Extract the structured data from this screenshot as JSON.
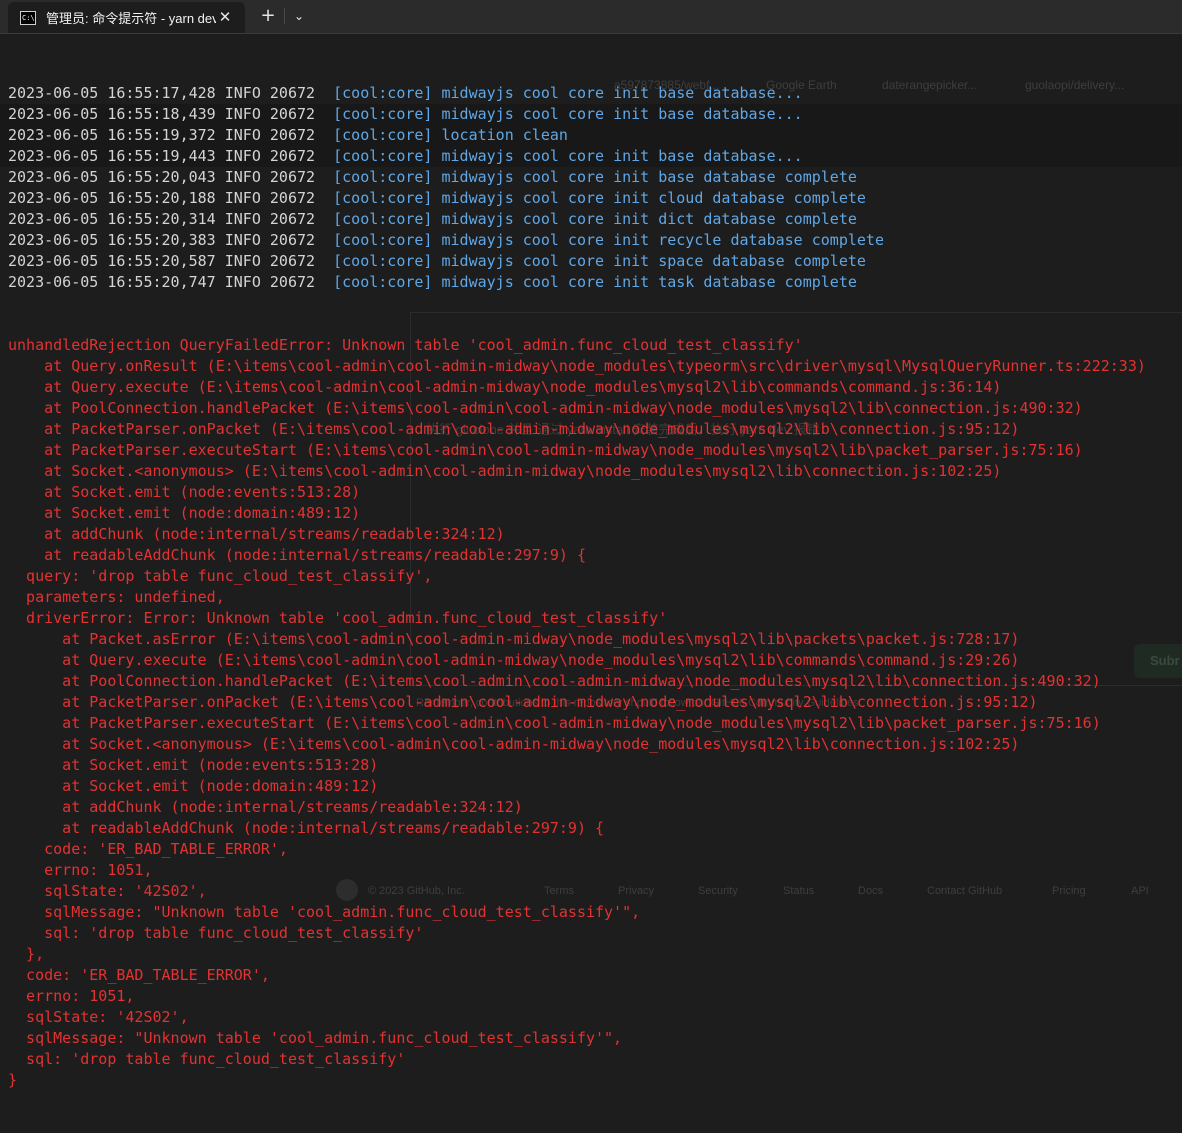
{
  "window": {
    "tab_title": "管理员: 命令提示符 - yarn  dev",
    "tab_icon_text": "C:\\",
    "close_glyph": "✕",
    "new_tab_glyph": "+",
    "dropdown_glyph": "⌄"
  },
  "background_ghost": {
    "bookmarks": [
      "a597873885/webf...",
      "Google Earth",
      "daterangepicker...",
      "guolaopi/delivery..."
    ],
    "comment_text": "执行 git clone 并且 通过 yarn install 安装完成后，执行 yarn dev 报错",
    "guidelines_text": "Remember, contributions to this repository should follow our GitHub Community Guidelines.",
    "submit_label": "Subr",
    "footer_copyright": "© 2023 GitHub, Inc.",
    "footer_links": [
      "Terms",
      "Privacy",
      "Security",
      "Status",
      "Docs",
      "Contact GitHub",
      "Pricing",
      "API"
    ]
  },
  "terminal": {
    "info_lines": [
      {
        "prefix": "2023-06-05 16:55:17,428 INFO 20672  ",
        "message": "[cool:core] midwayjs cool core init base database..."
      },
      {
        "prefix": "2023-06-05 16:55:18,439 INFO 20672  ",
        "message": "[cool:core] midwayjs cool core init base database..."
      },
      {
        "prefix": "2023-06-05 16:55:19,372 INFO 20672  ",
        "message": "[cool:core] location clean"
      },
      {
        "prefix": "2023-06-05 16:55:19,443 INFO 20672  ",
        "message": "[cool:core] midwayjs cool core init base database..."
      },
      {
        "prefix": "2023-06-05 16:55:20,043 INFO 20672  ",
        "message": "[cool:core] midwayjs cool core init base database complete"
      },
      {
        "prefix": "2023-06-05 16:55:20,188 INFO 20672  ",
        "message": "[cool:core] midwayjs cool core init cloud database complete"
      },
      {
        "prefix": "2023-06-05 16:55:20,314 INFO 20672  ",
        "message": "[cool:core] midwayjs cool core init dict database complete"
      },
      {
        "prefix": "2023-06-05 16:55:20,383 INFO 20672  ",
        "message": "[cool:core] midwayjs cool core init recycle database complete"
      },
      {
        "prefix": "2023-06-05 16:55:20,587 INFO 20672  ",
        "message": "[cool:core] midwayjs cool core init space database complete"
      },
      {
        "prefix": "2023-06-05 16:55:20,747 INFO 20672  ",
        "message": "[cool:core] midwayjs cool core init task database complete"
      }
    ],
    "error_lines": [
      "unhandledRejection QueryFailedError: Unknown table 'cool_admin.func_cloud_test_classify'",
      "    at Query.onResult (E:\\items\\cool-admin\\cool-admin-midway\\node_modules\\typeorm\\src\\driver\\mysql\\MysqlQueryRunner.ts:222:33)",
      "    at Query.execute (E:\\items\\cool-admin\\cool-admin-midway\\node_modules\\mysql2\\lib\\commands\\command.js:36:14)",
      "    at PoolConnection.handlePacket (E:\\items\\cool-admin\\cool-admin-midway\\node_modules\\mysql2\\lib\\connection.js:490:32)",
      "    at PacketParser.onPacket (E:\\items\\cool-admin\\cool-admin-midway\\node_modules\\mysql2\\lib\\connection.js:95:12)",
      "    at PacketParser.executeStart (E:\\items\\cool-admin\\cool-admin-midway\\node_modules\\mysql2\\lib\\packet_parser.js:75:16)",
      "    at Socket.<anonymous> (E:\\items\\cool-admin\\cool-admin-midway\\node_modules\\mysql2\\lib\\connection.js:102:25)",
      "    at Socket.emit (node:events:513:28)",
      "    at Socket.emit (node:domain:489:12)",
      "    at addChunk (node:internal/streams/readable:324:12)",
      "    at readableAddChunk (node:internal/streams/readable:297:9) {",
      "  query: 'drop table func_cloud_test_classify',",
      "  parameters: undefined,",
      "  driverError: Error: Unknown table 'cool_admin.func_cloud_test_classify'",
      "      at Packet.asError (E:\\items\\cool-admin\\cool-admin-midway\\node_modules\\mysql2\\lib\\packets\\packet.js:728:17)",
      "      at Query.execute (E:\\items\\cool-admin\\cool-admin-midway\\node_modules\\mysql2\\lib\\commands\\command.js:29:26)",
      "      at PoolConnection.handlePacket (E:\\items\\cool-admin\\cool-admin-midway\\node_modules\\mysql2\\lib\\connection.js:490:32)",
      "      at PacketParser.onPacket (E:\\items\\cool-admin\\cool-admin-midway\\node_modules\\mysql2\\lib\\connection.js:95:12)",
      "      at PacketParser.executeStart (E:\\items\\cool-admin\\cool-admin-midway\\node_modules\\mysql2\\lib\\packet_parser.js:75:16)",
      "      at Socket.<anonymous> (E:\\items\\cool-admin\\cool-admin-midway\\node_modules\\mysql2\\lib\\connection.js:102:25)",
      "      at Socket.emit (node:events:513:28)",
      "      at Socket.emit (node:domain:489:12)",
      "      at addChunk (node:internal/streams/readable:324:12)",
      "      at readableAddChunk (node:internal/streams/readable:297:9) {",
      "    code: 'ER_BAD_TABLE_ERROR',",
      "    errno: 1051,",
      "    sqlState: '42S02',",
      "    sqlMessage: \"Unknown table 'cool_admin.func_cloud_test_classify'\",",
      "    sql: 'drop table func_cloud_test_classify'",
      "  },",
      "  code: 'ER_BAD_TABLE_ERROR',",
      "  errno: 1051,",
      "  sqlState: '42S02',",
      "  sqlMessage: \"Unknown table 'cool_admin.func_cloud_test_classify'\",",
      "  sql: 'drop table func_cloud_test_classify'",
      "}"
    ]
  },
  "colors": {
    "background": "#1d1d1d",
    "default_text": "#d4d4d4",
    "info_text": "#5fa7e6",
    "error_text": "#e33232"
  }
}
